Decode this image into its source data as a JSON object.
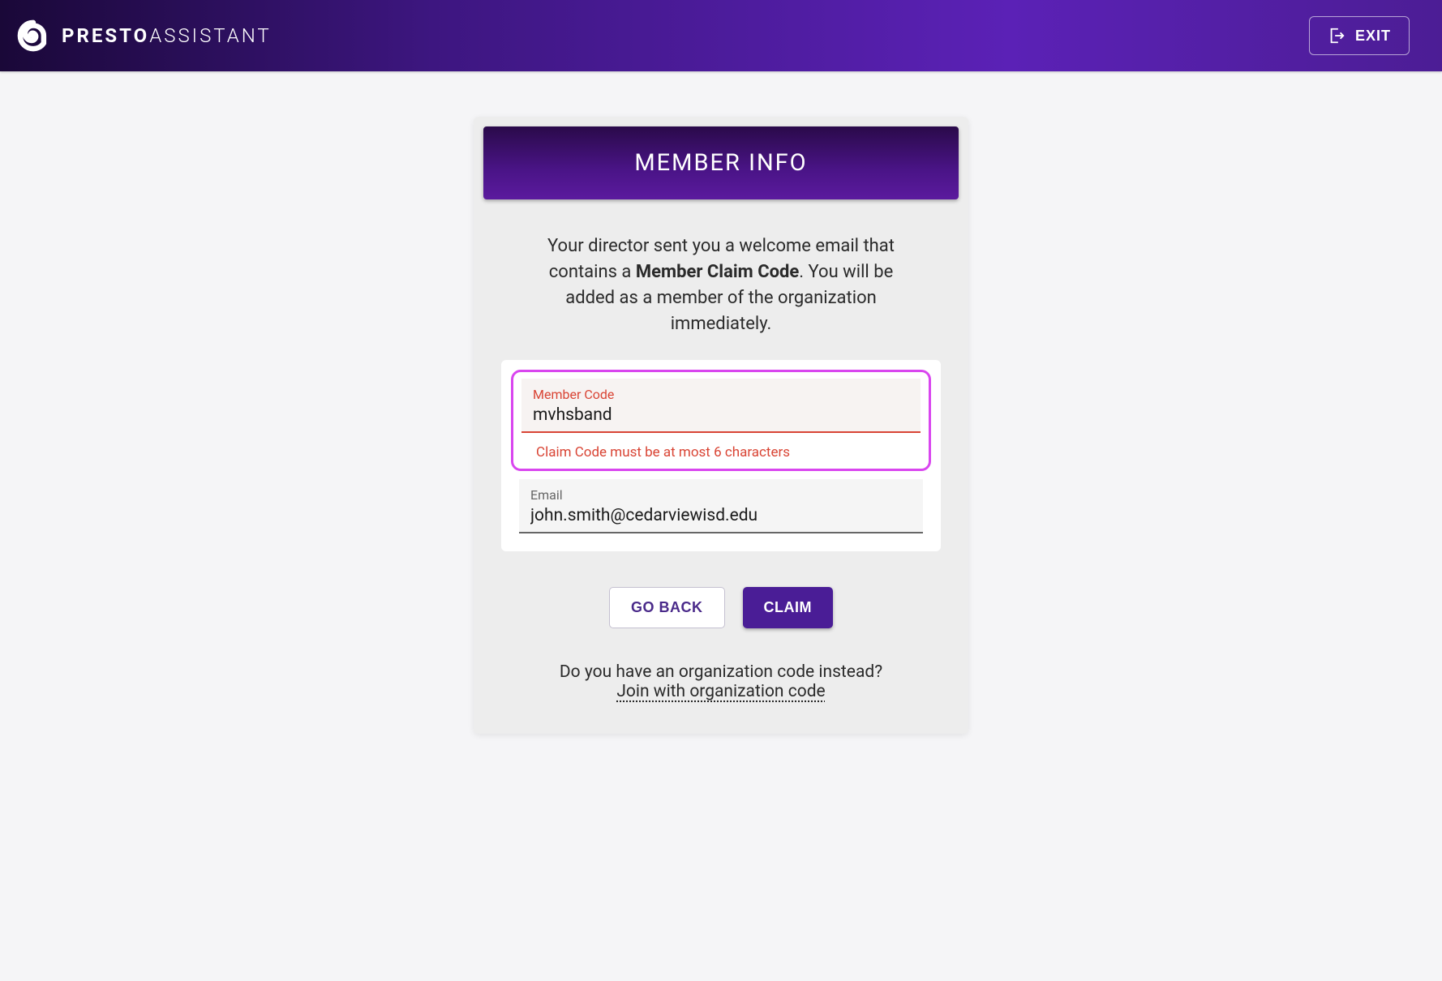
{
  "header": {
    "logo_bold": "PRESTO",
    "logo_light": "ASSISTANT",
    "exit_label": "EXIT"
  },
  "card": {
    "title": "MEMBER INFO",
    "description_part1": "Your director sent you a welcome email that contains a ",
    "description_bold": "Member Claim Code",
    "description_part2": ". You will be added as a member of the organization immediately.",
    "fields": {
      "member_code": {
        "label": "Member Code",
        "value": "mvhsband",
        "error": "Claim Code must be at most 6 characters"
      },
      "email": {
        "label": "Email",
        "value": "john.smith@cedarviewisd.edu"
      }
    },
    "buttons": {
      "go_back": "GO BACK",
      "claim": "CLAIM"
    },
    "footer": {
      "question": "Do you have an organization code instead?",
      "link": "Join with organization code"
    }
  }
}
